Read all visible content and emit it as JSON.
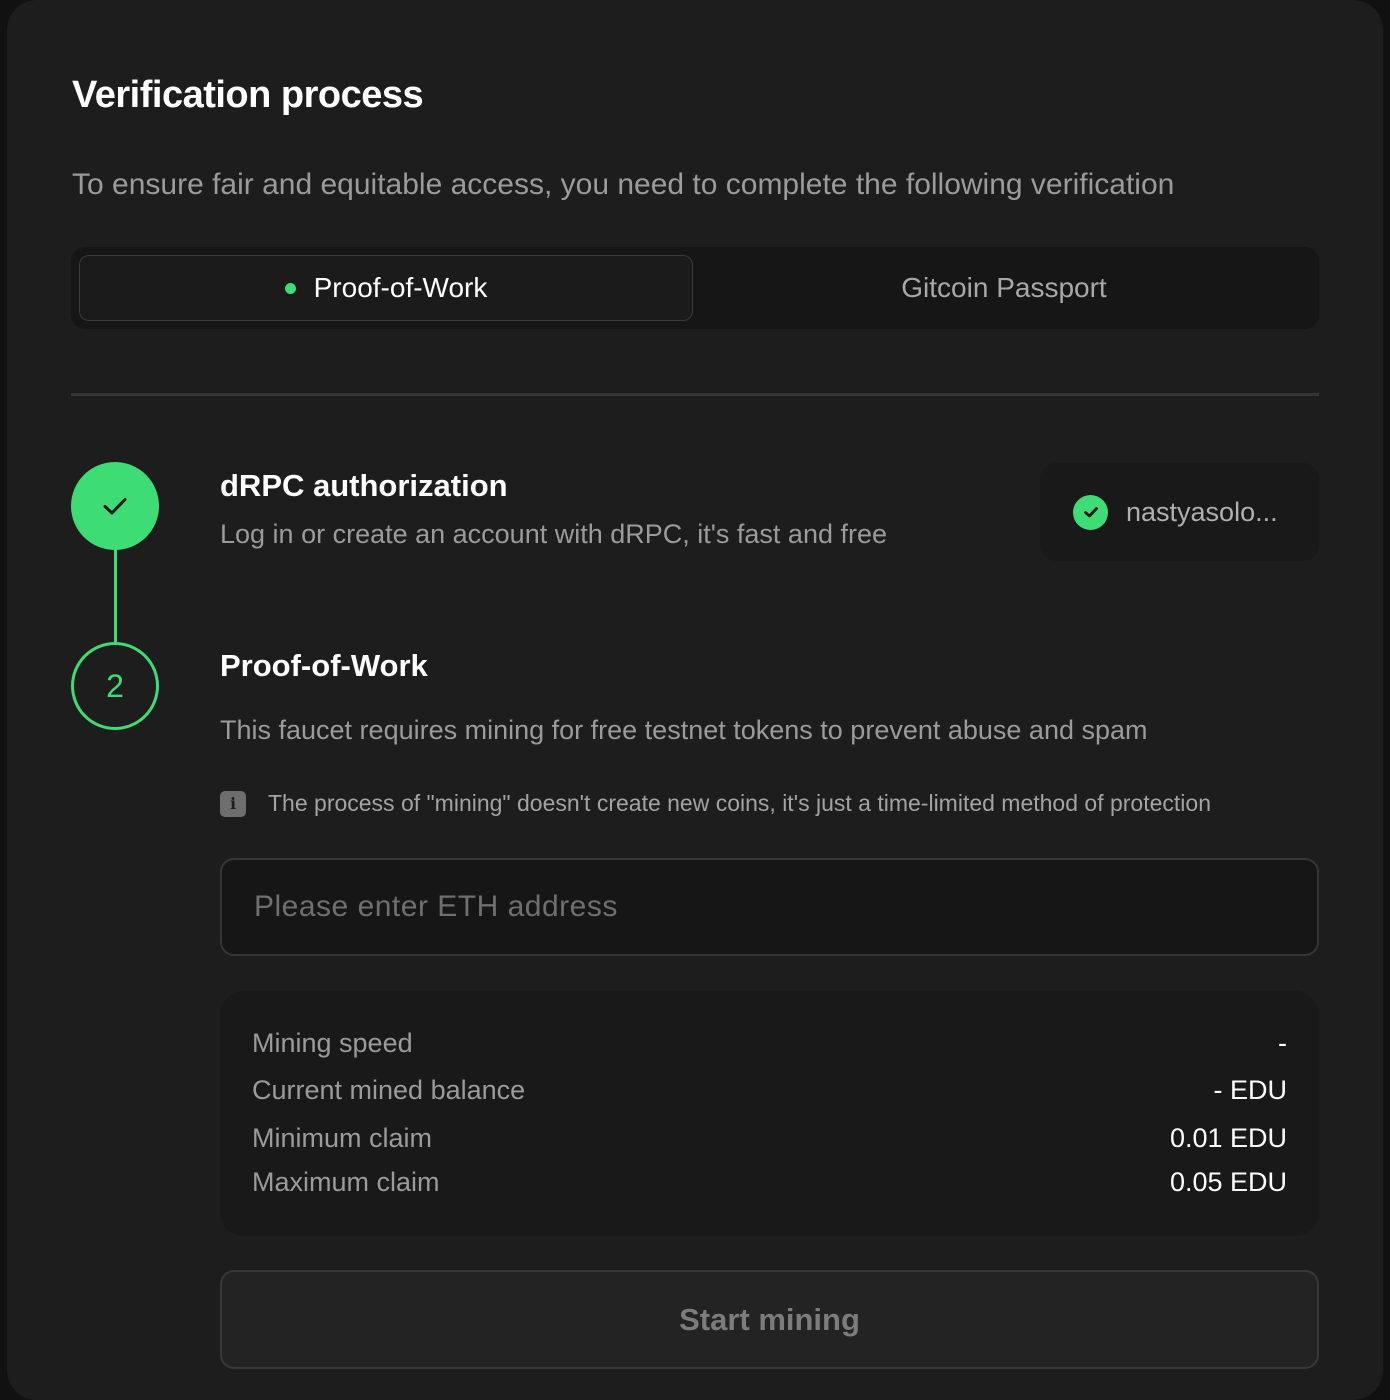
{
  "header": {
    "title": "Verification process",
    "subtitle": "To ensure fair and equitable access, you need to complete the following verification"
  },
  "tabs": [
    {
      "label": "Proof-of-Work",
      "active": true
    },
    {
      "label": "Gitcoin Passport",
      "active": false
    }
  ],
  "steps": {
    "auth": {
      "status": "done",
      "title": "dRPC authorization",
      "description": "Log in or create an account with dRPC, it's fast and free",
      "account_name": "nastyasolo..."
    },
    "pow": {
      "number": "2",
      "status": "active",
      "title": "Proof-of-Work",
      "description": "This faucet requires mining for free testnet tokens to prevent abuse and spam",
      "info_icon": "i",
      "info_text": "The process of \"mining\" doesn't create new coins, it's just a time-limited method of protection",
      "address_input": {
        "value": "",
        "placeholder": "Please enter ETH address"
      },
      "stats": [
        {
          "label": "Mining speed",
          "value": "-"
        },
        {
          "label": "Current mined balance",
          "value": "- EDU"
        },
        {
          "label": "Minimum claim",
          "value": "0.01 EDU"
        },
        {
          "label": "Maximum claim",
          "value": "0.05 EDU"
        }
      ],
      "start_button_label": "Start mining"
    }
  },
  "colors": {
    "accent": "#3ddc74",
    "card_background": "#1d1d1d",
    "page_background": "#111111"
  },
  "icons": {
    "step_done": "check-icon",
    "account_verified": "check-circle-icon",
    "info": "info-icon"
  }
}
